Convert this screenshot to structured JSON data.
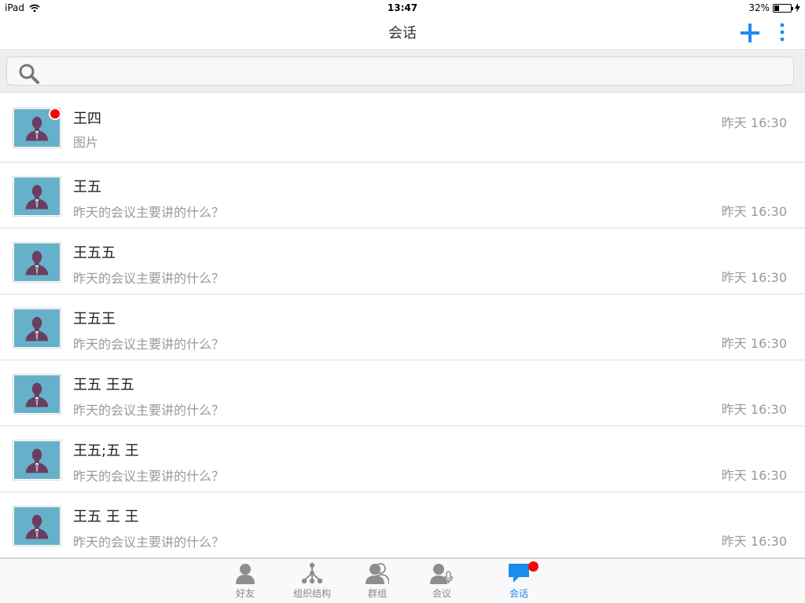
{
  "status_bar": {
    "device": "iPad",
    "time": "13:47",
    "battery": "32%",
    "battery_level": 0.32
  },
  "nav": {
    "title": "会话"
  },
  "search": {
    "placeholder": ""
  },
  "conversations": [
    {
      "name": "王四",
      "preview": "图片",
      "time": "昨天 16:30",
      "unread": true
    },
    {
      "name": "王五",
      "preview": "昨天的会议主要讲的什么？",
      "time": "昨天 16:30",
      "unread": false
    },
    {
      "name": "王五五",
      "preview": "昨天的会议主要讲的什么？",
      "time": "昨天 16:30",
      "unread": false
    },
    {
      "name": "王五王",
      "preview": "昨天的会议主要讲的什么？",
      "time": "昨天 16:30",
      "unread": false
    },
    {
      "name": "王五 王五",
      "preview": "昨天的会议主要讲的什么？",
      "time": "昨天 16:30",
      "unread": false
    },
    {
      "name": "王五;五 王",
      "preview": "昨天的会议主要讲的什么？",
      "time": "昨天 16:30",
      "unread": false
    },
    {
      "name": "王五 王 王",
      "preview": "昨天的会议主要讲的什么？",
      "time": "昨天 16:30",
      "unread": false
    }
  ],
  "tabs": [
    {
      "label": "好友",
      "icon": "person-icon",
      "active": false,
      "badge": false
    },
    {
      "label": "组织结构",
      "icon": "org-structure-icon",
      "active": false,
      "badge": false
    },
    {
      "label": "群组",
      "icon": "group-icon",
      "active": false,
      "badge": false
    },
    {
      "label": "会议",
      "icon": "meeting-icon",
      "active": false,
      "badge": false
    },
    {
      "label": "会话",
      "icon": "chat-bubble-icon",
      "active": true,
      "badge": true
    }
  ],
  "colors": {
    "accent": "#1a8cf0",
    "badge": "#ff0000",
    "avatar_bg": "#66b1c9",
    "inactive_icon": "#8e8e8e"
  }
}
